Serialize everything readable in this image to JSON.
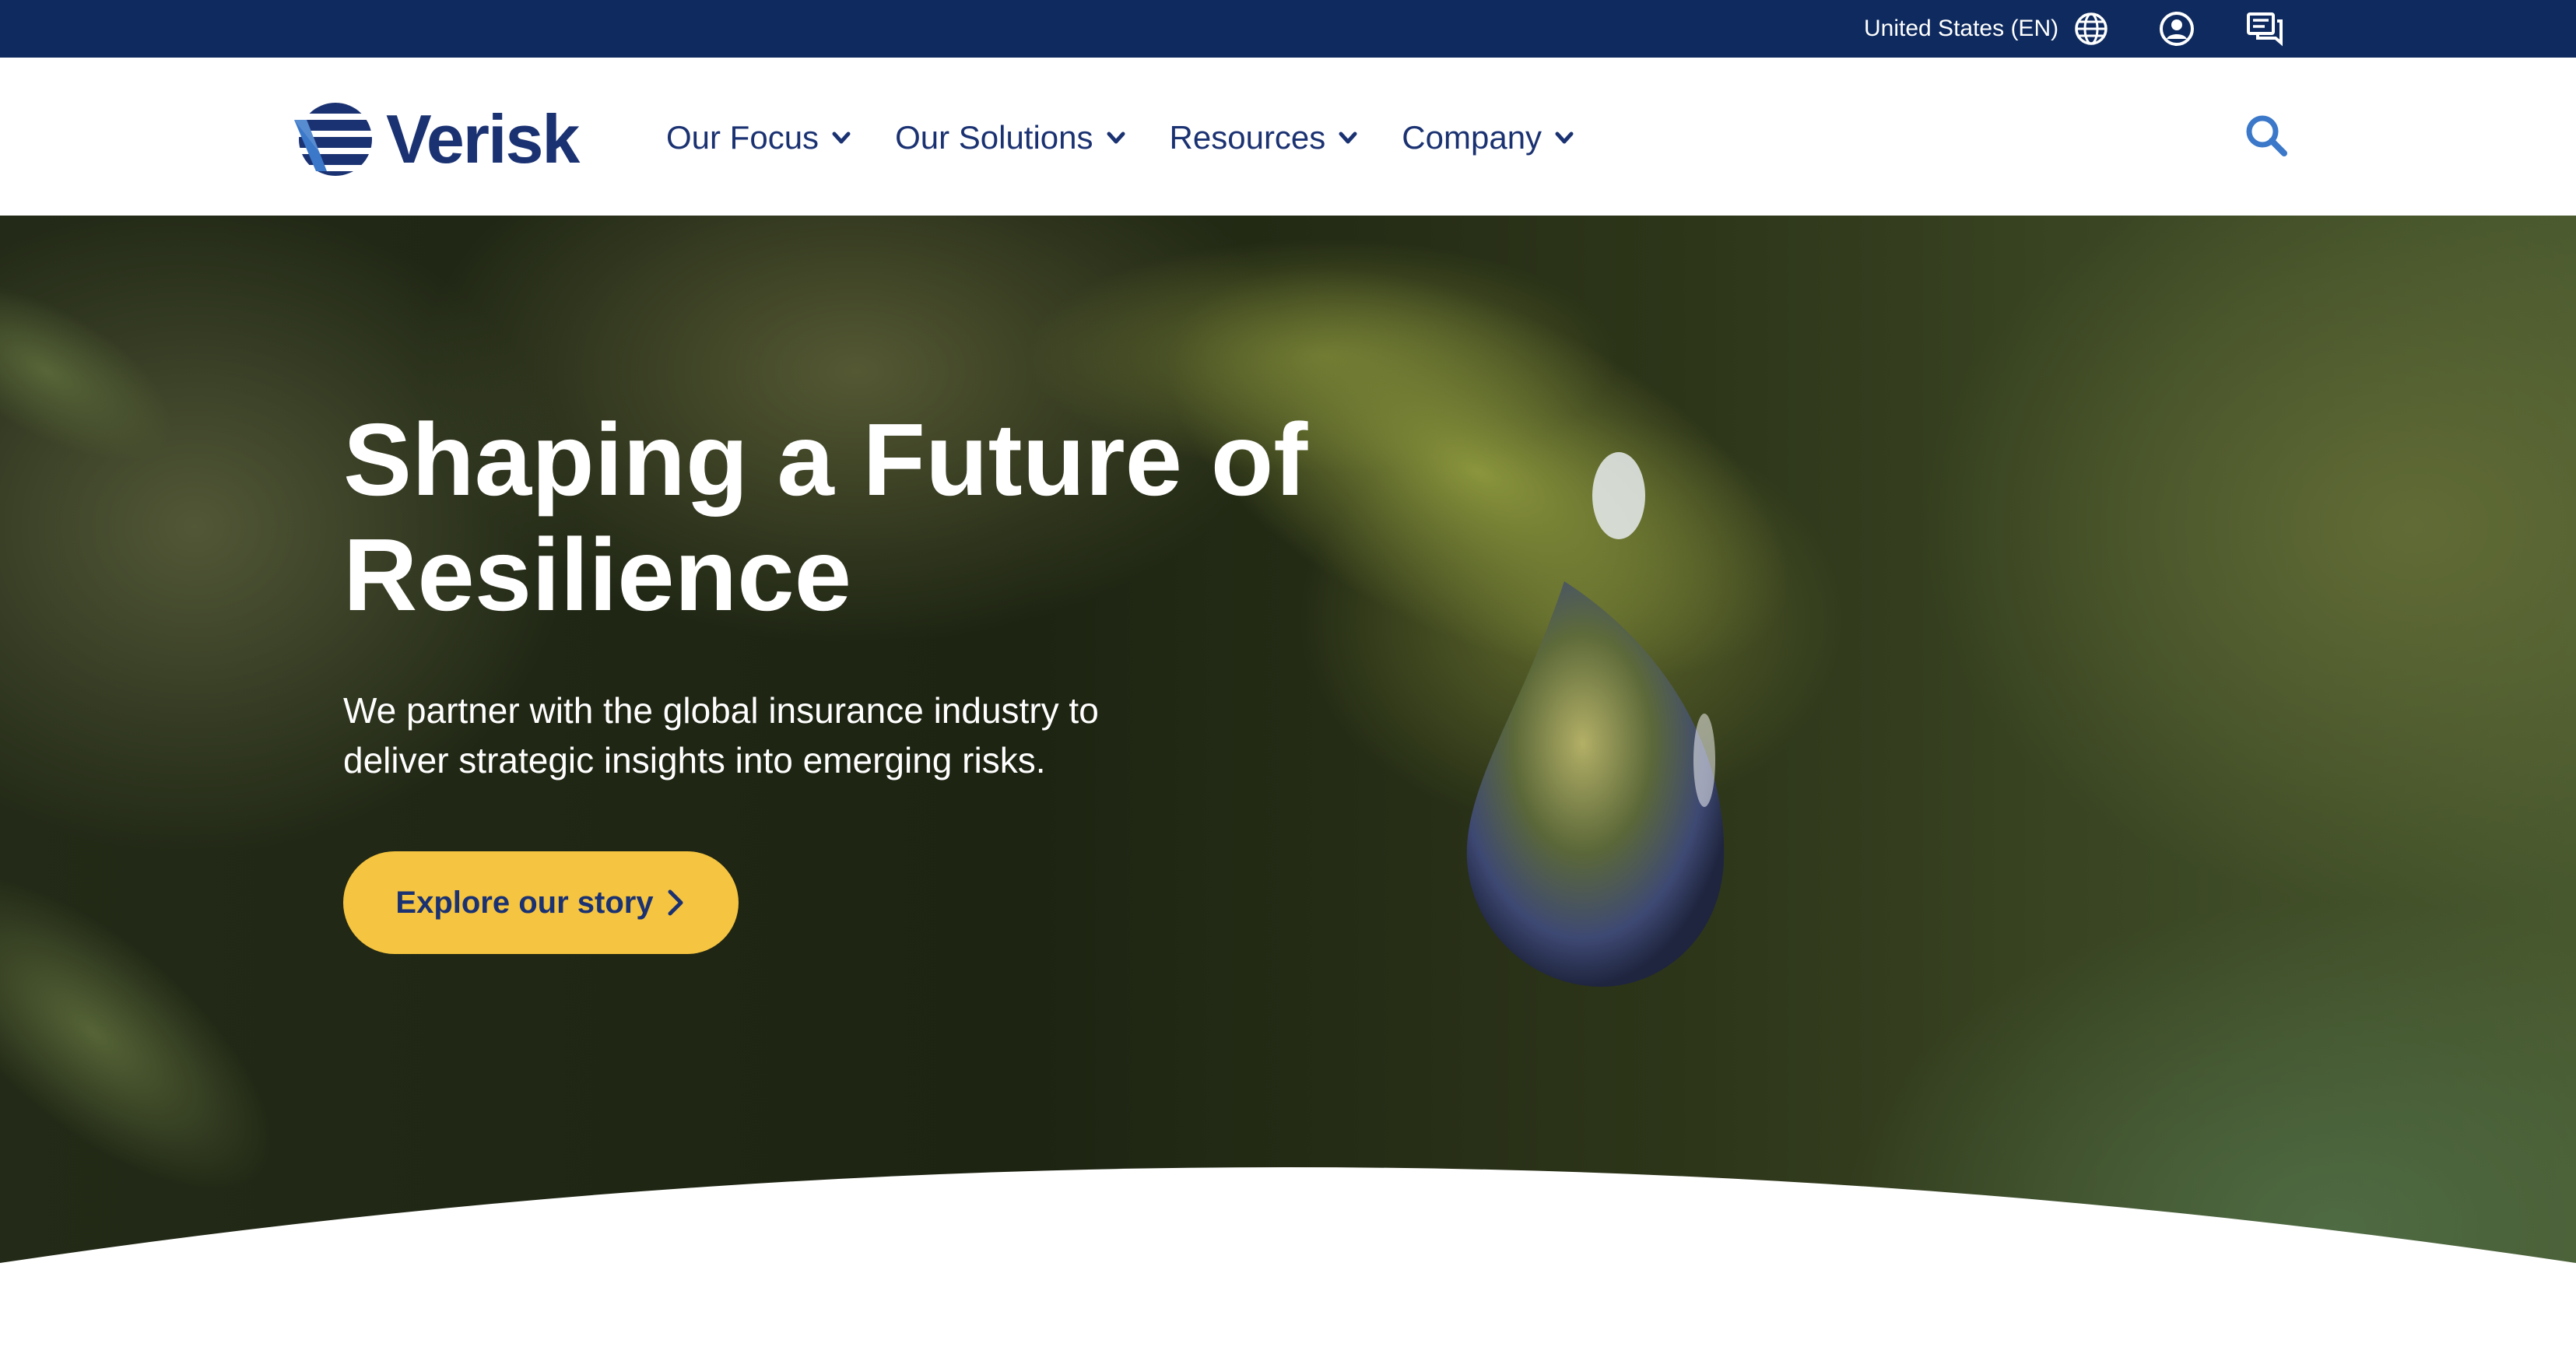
{
  "utility_bar": {
    "locale_label": "United States (EN)",
    "icons": [
      "globe-icon",
      "account-icon",
      "contact-chat-icon"
    ]
  },
  "header": {
    "logo_text": "Verisk",
    "nav": [
      {
        "label": "Our Focus"
      },
      {
        "label": "Our Solutions"
      },
      {
        "label": "Resources"
      },
      {
        "label": "Company"
      }
    ],
    "search_icon": "search-icon"
  },
  "hero": {
    "title_line1": "Shaping a Future of",
    "title_line2": "Resilience",
    "subtitle_line1": "We partner with the global insurance industry to",
    "subtitle_line2": "deliver strategic insights into emerging risks.",
    "cta_label": "Explore our story"
  },
  "colors": {
    "utility_bar": "#0e2a5e",
    "brand_navy": "#1b3272",
    "accent_blue": "#3b78c9",
    "cta_yellow": "#f5c440"
  }
}
